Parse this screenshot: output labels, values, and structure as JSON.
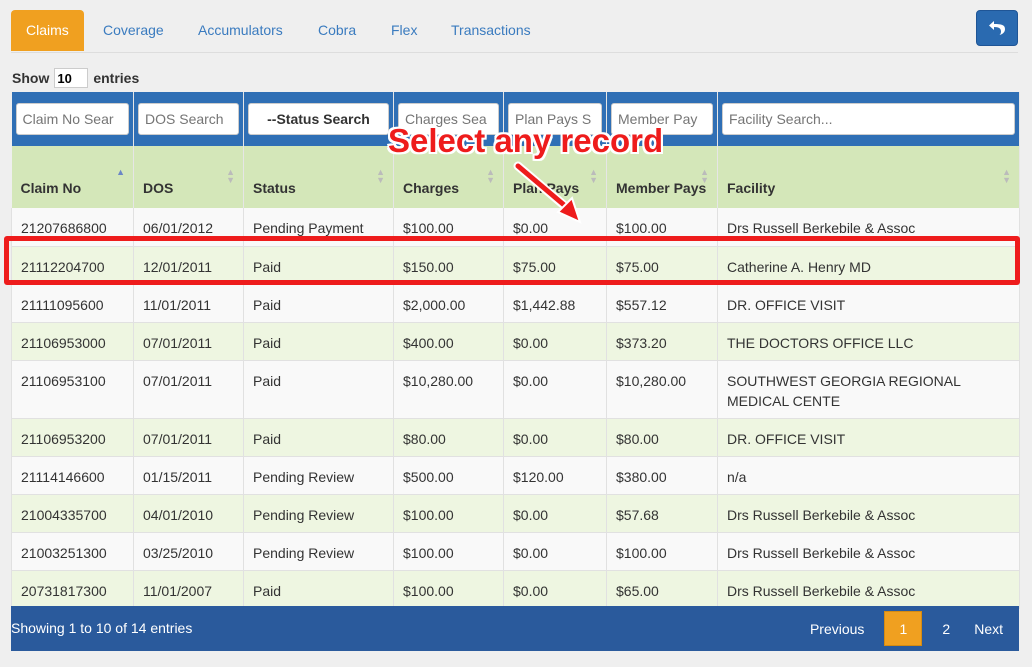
{
  "tabs": [
    {
      "label": "Claims"
    },
    {
      "label": "Coverage"
    },
    {
      "label": "Accumulators"
    },
    {
      "label": "Cobra"
    },
    {
      "label": "Flex"
    },
    {
      "label": "Transactions"
    }
  ],
  "back_button_icon": "undo-arrow-icon",
  "show_entries": {
    "prefix": "Show",
    "value": "10",
    "suffix": "entries"
  },
  "search": {
    "claim_no": "Claim No Sear",
    "dos": "DOS Search",
    "status": "--Status Search",
    "charges": "Charges Sea",
    "plan_pays": "Plan Pays S",
    "member_pays": "Member Pay",
    "facility": "Facility Search..."
  },
  "columns": [
    "Claim No",
    "DOS",
    "Status",
    "Charges",
    "Plan Pays",
    "Member Pays",
    "Facility"
  ],
  "rows": [
    [
      "21207686800",
      "06/01/2012",
      "Pending Payment",
      "$100.00",
      "$0.00",
      "$100.00",
      "Drs Russell Berkebile & Assoc"
    ],
    [
      "21112204700",
      "12/01/2011",
      "Paid",
      "$150.00",
      "$75.00",
      "$75.00",
      "Catherine A. Henry MD"
    ],
    [
      "21111095600",
      "11/01/2011",
      "Paid",
      "$2,000.00",
      "$1,442.88",
      "$557.12",
      "DR. OFFICE VISIT"
    ],
    [
      "21106953000",
      "07/01/2011",
      "Paid",
      "$400.00",
      "$0.00",
      "$373.20",
      "THE DOCTORS OFFICE LLC"
    ],
    [
      "21106953100",
      "07/01/2011",
      "Paid",
      "$10,280.00",
      "$0.00",
      "$10,280.00",
      "SOUTHWEST GEORGIA REGIONAL MEDICAL CENTE"
    ],
    [
      "21106953200",
      "07/01/2011",
      "Paid",
      "$80.00",
      "$0.00",
      "$80.00",
      "DR. OFFICE VISIT"
    ],
    [
      "21114146600",
      "01/15/2011",
      "Pending Review",
      "$500.00",
      "$120.00",
      "$380.00",
      "n/a"
    ],
    [
      "21004335700",
      "04/01/2010",
      "Pending Review",
      "$100.00",
      "$0.00",
      "$57.68",
      "Drs Russell Berkebile & Assoc"
    ],
    [
      "21003251300",
      "03/25/2010",
      "Pending Review",
      "$100.00",
      "$0.00",
      "$100.00",
      "Drs Russell Berkebile & Assoc"
    ],
    [
      "20731817300",
      "11/01/2007",
      "Paid",
      "$100.00",
      "$0.00",
      "$65.00",
      "Drs Russell Berkebile & Assoc"
    ]
  ],
  "footer": {
    "info": "Showing 1 to 10 of 14 entries",
    "previous": "Previous",
    "pages": [
      "1",
      "2"
    ],
    "next": "Next"
  },
  "annotation": {
    "callout": "Select any record"
  },
  "colors": {
    "accent": "#f0a020",
    "header_blue": "#2f6fb5",
    "highlight_red": "#ee1c1c"
  }
}
